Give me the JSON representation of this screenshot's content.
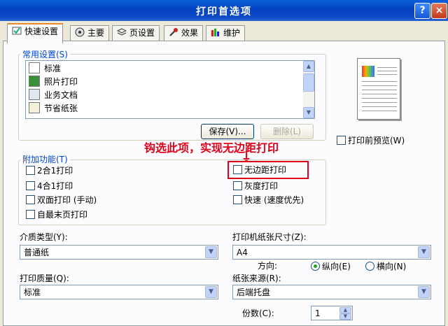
{
  "window": {
    "title": "打印首选项",
    "help_label": "?",
    "close_label": "×"
  },
  "tabs": [
    {
      "label": "快速设置",
      "icon": "quick-setup-icon"
    },
    {
      "label": "主要",
      "icon": "main-icon"
    },
    {
      "label": "页设置",
      "icon": "page-setup-icon"
    },
    {
      "label": "效果",
      "icon": "effects-icon"
    },
    {
      "label": "维护",
      "icon": "maintenance-icon"
    }
  ],
  "common_settings": {
    "label": "常用设置(S)",
    "items": [
      "标准",
      "照片打印",
      "业务文档",
      "节省纸张"
    ],
    "save_label": "保存(V)...",
    "delete_label": "删除(L)"
  },
  "preview_checkbox": "打印前预览(W)",
  "annotation": "钩选此项，实现无边距打印",
  "additional": {
    "label": "附加功能(T)",
    "left": [
      "2合1打印",
      "4合1打印",
      "双面打印 (手动)",
      "自最末页打印"
    ],
    "right": [
      "无边距打印",
      "灰度打印",
      "快速 (速度优先)"
    ]
  },
  "media_type": {
    "label": "介质类型(Y):",
    "value": "普通纸"
  },
  "print_quality": {
    "label": "打印质量(Q):",
    "value": "标准"
  },
  "paper_size": {
    "label": "打印机纸张尺寸(Z):",
    "value": "A4"
  },
  "orientation": {
    "label": "方向:",
    "portrait": "纵向(E)",
    "landscape": "横向(N)",
    "selected": "portrait"
  },
  "paper_source": {
    "label": "纸张来源(R):",
    "value": "后端托盘"
  },
  "copies": {
    "label": "份数(C):",
    "value": "1"
  },
  "colors": {
    "annotation": "#e0001a",
    "group_label": "#0046d5",
    "active_tab": "#e68b2c"
  }
}
